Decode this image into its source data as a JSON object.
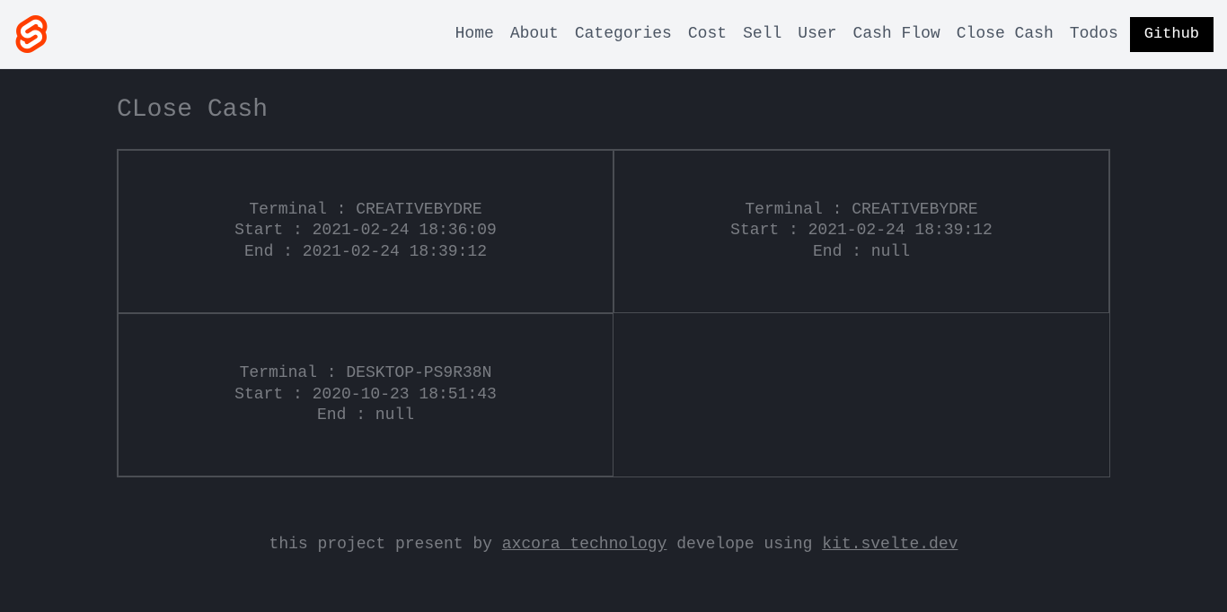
{
  "nav": {
    "items": [
      {
        "label": "Home"
      },
      {
        "label": "About"
      },
      {
        "label": "Categories"
      },
      {
        "label": "Cost"
      },
      {
        "label": "Sell"
      },
      {
        "label": "User"
      },
      {
        "label": "Cash Flow"
      },
      {
        "label": "Close Cash"
      },
      {
        "label": "Todos"
      }
    ],
    "github": "Github"
  },
  "page": {
    "title": "CLose Cash"
  },
  "cards": [
    {
      "terminal": "Terminal : CREATIVEBYDRE",
      "start": "Start : 2021-02-24 18:36:09",
      "end": "End : 2021-02-24 18:39:12"
    },
    {
      "terminal": "Terminal : CREATIVEBYDRE",
      "start": "Start : 2021-02-24 18:39:12",
      "end": "End : null"
    },
    {
      "terminal": "Terminal : DESKTOP-PS9R38N",
      "start": "Start : 2020-10-23 18:51:43",
      "end": "End : null"
    }
  ],
  "footer": {
    "prefix": "this project present by ",
    "link1": "axcora technology",
    "middle": " develope using ",
    "link2": "kit.svelte.dev"
  }
}
